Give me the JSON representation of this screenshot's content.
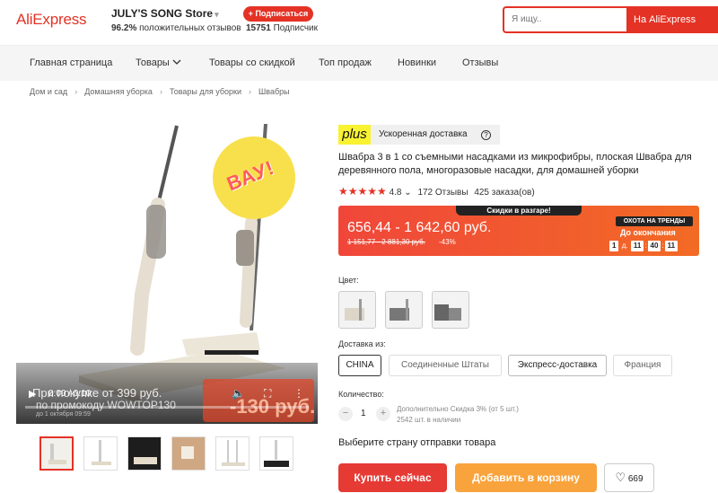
{
  "header": {
    "logo": "AliExpress",
    "store_name": "JULY'S SONG Store",
    "store_chevron": "▾",
    "positive_pct": "96.2%",
    "positive_label": "положительных отзывов",
    "subscribe_label": "+ Подписаться",
    "subscribers_count": "15751",
    "subscribers_label": "Подписчик",
    "search_placeholder": "Я ищу..",
    "search_button": "На AliExpress"
  },
  "nav": {
    "items": [
      "Главная страница",
      "Товары",
      "Товары со скидкой",
      "Топ продаж",
      "Новинки",
      "Отзывы"
    ]
  },
  "breadcrumbs": [
    "Дом и сад",
    "Домашняя уборка",
    "Товары для уборки",
    "Швабры"
  ],
  "gallery": {
    "badge_text": "ВАУ!",
    "promo_line1": "При покупке от 399 руб.",
    "promo_line2": "по промокоду WOWTOP130",
    "promo_line3": "до 1 октября 09:59",
    "promo_price": "-130 руб.",
    "video_time": "0:00 / 0:10"
  },
  "product": {
    "plus_logo": "plus",
    "delivery_label": "Ускоренная доставка",
    "help": "?",
    "title": "Швабра 3 в 1 со съемными насадками из микрофибры, плоская Швабра для деревянного пола, многоразовые насадки, для домашней уборки",
    "stars": "★★★★★",
    "rating": "4.8",
    "reviews": "172 Отзывы",
    "orders": "425 заказа(ов)"
  },
  "price": {
    "sale_tag": "Скидки в разгаре!",
    "current": "656,44 - 1 642,60 руб.",
    "old": "1 151,77 - 2 881,30 руб.",
    "discount": "-43%",
    "trend_tag": "ОХОТА НА ТРЕНДЫ",
    "until_label": "До окончания",
    "timer_days": "1",
    "timer_days_label": "д.",
    "timer_h": "11",
    "timer_m": "40",
    "timer_s": "11"
  },
  "options": {
    "color_label": "Цвет:",
    "ship_from_label": "Доставка из:",
    "ship_from": [
      "CHINA",
      "Соединенные Штаты",
      "Экспресс-доставка",
      "Франция"
    ],
    "qty_label": "Количество:",
    "qty_value": "1",
    "qty_discount": "Дополнительно Скидка 3% (от 5 шт.)",
    "qty_stock": "2542 шт. в наличии",
    "select_country": "Выберите страну отправки товара"
  },
  "actions": {
    "buy": "Купить сейчас",
    "cart": "Добавить в корзину",
    "wish_count": "669"
  }
}
